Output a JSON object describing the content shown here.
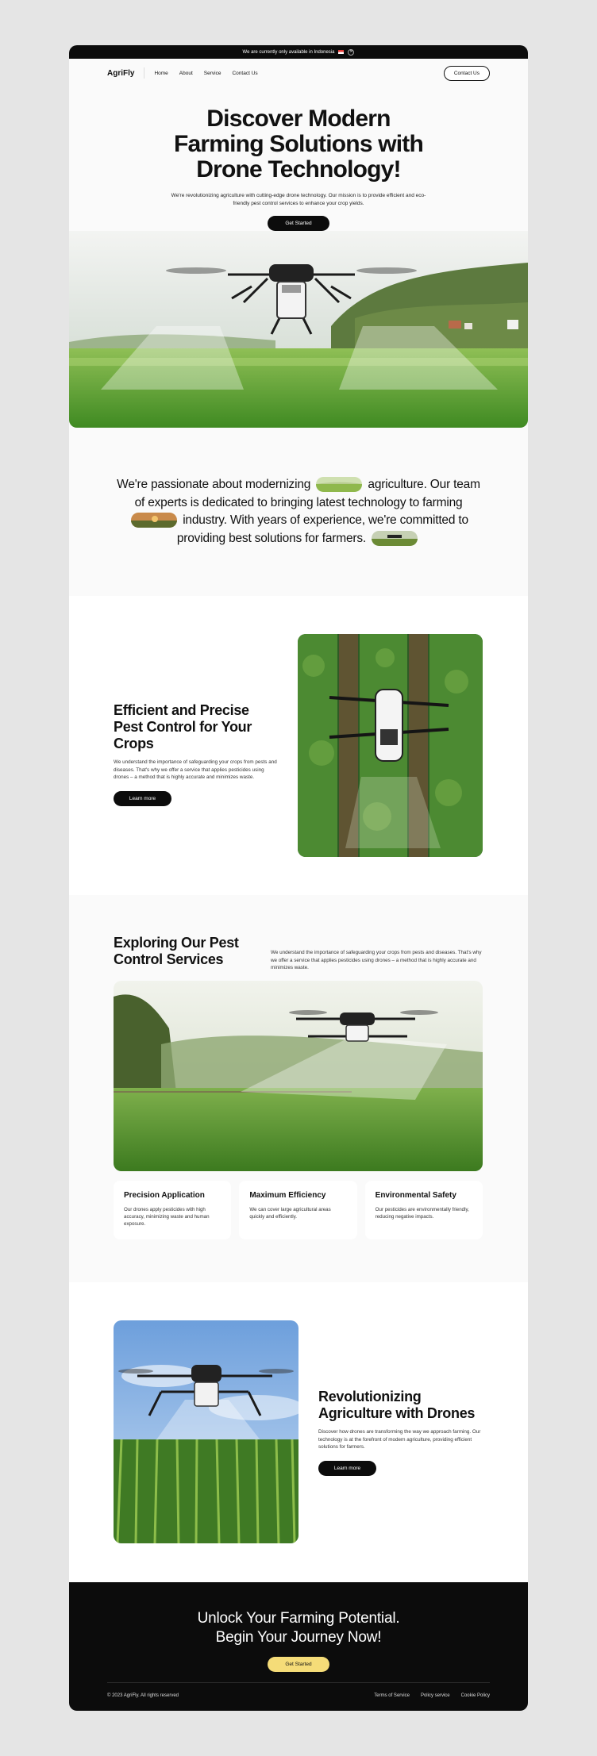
{
  "topbar": {
    "notice": "We are currently only available in Indonesia",
    "close_icon": "close-icon"
  },
  "nav": {
    "logo": "AgriFly",
    "links": [
      "Home",
      "About",
      "Service",
      "Contact Us"
    ],
    "cta": "Contact Us"
  },
  "hero": {
    "title_line1": "Discover Modern",
    "title_line2": "Farming Solutions with",
    "title_line3": "Drone Technology!",
    "subtitle": "We're revolutionizing agriculture with cutting-edge drone technology. Our mission is to provide efficient and eco-friendly pest control services to enhance your crop yields.",
    "cta": "Get Started"
  },
  "about": {
    "part1": "We're passionate about modernizing",
    "part2": "agriculture. Our team of experts is dedicated to bringing latest technology to farming",
    "part3": "industry. With years of experience, we're committed to providing best solutions for farmers."
  },
  "pest": {
    "title": "Efficient and Precise Pest Control for Your Crops",
    "body": "We understand the importance of safeguarding your crops from pests and diseases. That's why we offer a service that applies pesticides using drones – a method that is highly accurate and minimizes waste.",
    "cta": "Learn more"
  },
  "services": {
    "title": "Exploring Our Pest Control Services",
    "desc": "We understand the importance of safeguarding your crops from pests and diseases. That's why we offer a service that applies pesticides using drones – a method that is highly accurate and minimizes waste.",
    "cards": [
      {
        "title": "Precision Application",
        "body": "Our drones apply pesticides with high accuracy, minimizing waste and human exposure."
      },
      {
        "title": "Maximum Efficiency",
        "body": "We can cover large agricultural areas quickly and efficiently."
      },
      {
        "title": "Environmental Safety",
        "body": "Our pesticides are environmentally friendly, reducing negative impacts."
      }
    ]
  },
  "revo": {
    "title": "Revolutionizing Agriculture with Drones",
    "body": "Discover how drones are transforming the way we approach farming. Our technology is at the forefront of modern agriculture, providing efficient solutions for farmers.",
    "cta": "Learn more"
  },
  "footer": {
    "headline_line1": "Unlock Your Farming Potential.",
    "headline_line2": "Begin Your Journey Now!",
    "cta": "Get Started",
    "copyright": "© 2023 AgriFly. All rights reserved",
    "links": [
      "Terms of Service",
      "Policy service",
      "Cookie Policy"
    ]
  },
  "colors": {
    "dark": "#0c0c0c",
    "accent_yellow": "#f5dc78",
    "page_bg": "#fafafa"
  }
}
